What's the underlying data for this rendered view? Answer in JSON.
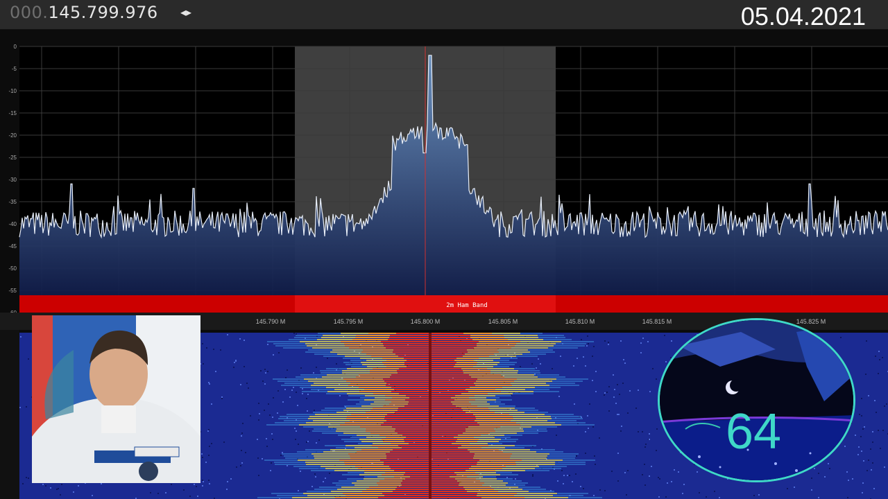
{
  "header": {
    "freq_prefix": "000.",
    "freq_value": "145.799.976",
    "arrows": "◂▸",
    "date": "05.04.2021"
  },
  "spectrum": {
    "y_ticks": [
      "0",
      "-5",
      "-10",
      "-15",
      "-20",
      "-25",
      "-30",
      "-35",
      "-40",
      "-45",
      "-50",
      "-55",
      "-60"
    ],
    "x_ticks": [
      "145.790 M",
      "145.795 M",
      "145.800 M",
      "145.805 M",
      "145.810 M",
      "145.815 M",
      "145.825 M"
    ],
    "band_label": "2m Ham Band",
    "colors": {
      "band": "#cc0000",
      "trace": "#e8eef8",
      "fill_top": "#6c94c4",
      "fill_bottom": "#0a1440",
      "highlight": "#4a4a4a"
    }
  },
  "overlay": {
    "badge_number": "64"
  }
}
